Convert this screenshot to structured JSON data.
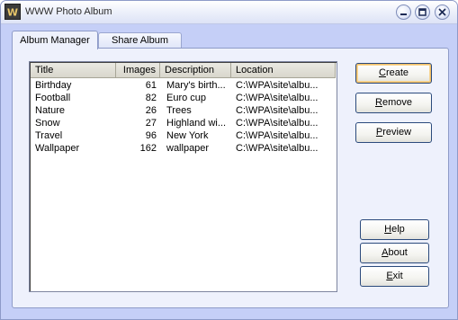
{
  "window": {
    "title": "WWW Photo Album",
    "app_icon_letter": "W"
  },
  "tabs": [
    {
      "label": "Album Manager",
      "active": true
    },
    {
      "label": "Share Album",
      "active": false
    }
  ],
  "album_list": {
    "columns": [
      "Title",
      "Images",
      "Description",
      "Location"
    ],
    "rows": [
      {
        "title": "Birthday",
        "images": "61",
        "description": "Mary's birth...",
        "location": "C:\\WPA\\site\\albu..."
      },
      {
        "title": "Football",
        "images": "82",
        "description": "Euro cup",
        "location": "C:\\WPA\\site\\albu..."
      },
      {
        "title": "Nature",
        "images": "26",
        "description": "Trees",
        "location": "C:\\WPA\\site\\albu..."
      },
      {
        "title": "Snow",
        "images": "27",
        "description": "Highland wi...",
        "location": "C:\\WPA\\site\\albu..."
      },
      {
        "title": "Travel",
        "images": "96",
        "description": "New York",
        "location": "C:\\WPA\\site\\albu..."
      },
      {
        "title": "Wallpaper",
        "images": "162",
        "description": "wallpaper",
        "location": "C:\\WPA\\site\\albu..."
      }
    ]
  },
  "buttons": {
    "create": {
      "mnemonic": "C",
      "rest": "reate"
    },
    "remove": {
      "mnemonic": "R",
      "rest": "emove"
    },
    "preview": {
      "mnemonic": "P",
      "rest": "review"
    },
    "help": {
      "mnemonic": "H",
      "rest": "elp"
    },
    "about": {
      "mnemonic": "A",
      "rest": "bout"
    },
    "exit": {
      "mnemonic": "E",
      "rest": "xit"
    }
  },
  "colors": {
    "window_bg": "#c5cff7",
    "panel_bg": "#eef1fc",
    "default_button_highlight": "#f2bf66"
  }
}
